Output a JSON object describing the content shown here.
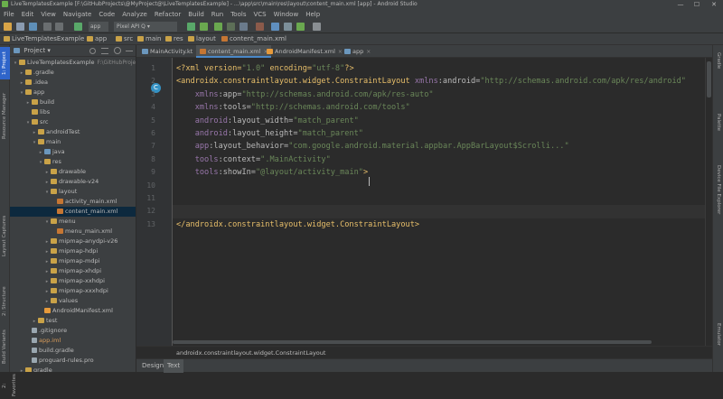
{
  "window": {
    "title": "LiveTemplatesExample [F:\\GitHubProjects\\@MyProject@\\LiveTemplatesExample] - ...\\app\\src\\main\\res\\layout\\content_main.xml [app] - Android Studio",
    "minimize": "—",
    "maximize": "☐",
    "close": "✕"
  },
  "menu": [
    "File",
    "Edit",
    "View",
    "Navigate",
    "Code",
    "Analyze",
    "Refactor",
    "Build",
    "Run",
    "Tools",
    "VCS",
    "Window",
    "Help"
  ],
  "toolbar": {
    "device": "Pixel API Q",
    "device_arrow": "▾",
    "colors": {
      "run": "#59a869",
      "debug": "#6aa84f",
      "build": "#4a88c7"
    }
  },
  "navbar": {
    "items": [
      "LiveTemplatesExample",
      "app",
      "src",
      "main",
      "res",
      "layout",
      "content_main.xml"
    ]
  },
  "left_strip": [
    "1: Project",
    "Resource Manager",
    "Layout Captures",
    "2: Structure",
    "Build Variants",
    "2: Favorites"
  ],
  "right_strip": [
    "Gradle",
    "Palette",
    "Device File Explorer",
    "Emulator"
  ],
  "project_panel": {
    "header": "Project",
    "header_arrow": "▾",
    "tree": [
      {
        "label": "LiveTemplatesExample",
        "extra": "F:\\GitHubProjects\\@",
        "arrow": "▾",
        "level": 0,
        "icon": "folder"
      },
      {
        "label": ".gradle",
        "arrow": "▸",
        "level": 1,
        "icon": "folder"
      },
      {
        "label": ".idea",
        "arrow": "▸",
        "level": 1,
        "icon": "folder"
      },
      {
        "label": "app",
        "arrow": "▾",
        "level": 1,
        "icon": "folder"
      },
      {
        "label": "build",
        "arrow": "▸",
        "level": 2,
        "icon": "folder"
      },
      {
        "label": "libs",
        "arrow": "",
        "level": 2,
        "icon": "folder"
      },
      {
        "label": "src",
        "arrow": "▾",
        "level": 2,
        "icon": "folder"
      },
      {
        "label": "androidTest",
        "arrow": "▸",
        "level": 3,
        "icon": "folder"
      },
      {
        "label": "main",
        "arrow": "▾",
        "level": 3,
        "icon": "folder"
      },
      {
        "label": "java",
        "arrow": "▸",
        "level": 4,
        "icon": "blue"
      },
      {
        "label": "res",
        "arrow": "▾",
        "level": 4,
        "icon": "folder"
      },
      {
        "label": "drawable",
        "arrow": "▸",
        "level": 5,
        "icon": "folder"
      },
      {
        "label": "drawable-v24",
        "arrow": "▸",
        "level": 5,
        "icon": "folder"
      },
      {
        "label": "layout",
        "arrow": "▾",
        "level": 5,
        "icon": "folder"
      },
      {
        "label": "activity_main.xml",
        "arrow": "",
        "level": 6,
        "icon": "lay"
      },
      {
        "label": "content_main.xml",
        "arrow": "",
        "level": 6,
        "icon": "lay",
        "selected": true
      },
      {
        "label": "menu",
        "arrow": "▾",
        "level": 5,
        "icon": "folder"
      },
      {
        "label": "menu_main.xml",
        "arrow": "",
        "level": 6,
        "icon": "lay"
      },
      {
        "label": "mipmap-anydpi-v26",
        "arrow": "▸",
        "level": 5,
        "icon": "folder"
      },
      {
        "label": "mipmap-hdpi",
        "arrow": "▸",
        "level": 5,
        "icon": "folder"
      },
      {
        "label": "mipmap-mdpi",
        "arrow": "▸",
        "level": 5,
        "icon": "folder"
      },
      {
        "label": "mipmap-xhdpi",
        "arrow": "▸",
        "level": 5,
        "icon": "folder"
      },
      {
        "label": "mipmap-xxhdpi",
        "arrow": "▸",
        "level": 5,
        "icon": "folder"
      },
      {
        "label": "mipmap-xxxhdpi",
        "arrow": "▸",
        "level": 5,
        "icon": "folder"
      },
      {
        "label": "values",
        "arrow": "▸",
        "level": 5,
        "icon": "folder"
      },
      {
        "label": "AndroidManifest.xml",
        "arrow": "",
        "level": 4,
        "icon": "xml"
      },
      {
        "label": "test",
        "arrow": "▸",
        "level": 3,
        "icon": "folder"
      },
      {
        "label": ".gitignore",
        "arrow": "",
        "level": 2,
        "icon": "file"
      },
      {
        "label": "app.iml",
        "arrow": "",
        "level": 2,
        "icon": "file",
        "orange": true
      },
      {
        "label": "build.gradle",
        "arrow": "",
        "level": 2,
        "icon": "file"
      },
      {
        "label": "proguard-rules.pro",
        "arrow": "",
        "level": 2,
        "icon": "file"
      },
      {
        "label": "gradle",
        "arrow": "▸",
        "level": 1,
        "icon": "folder"
      }
    ]
  },
  "tabs": [
    {
      "label": "MainActivity.kt",
      "icon": "blue"
    },
    {
      "label": "content_main.xml",
      "icon": "lay",
      "active": true
    },
    {
      "label": "AndroidManifest.xml",
      "icon": "xml"
    },
    {
      "label": "app",
      "icon": "blue"
    }
  ],
  "tab_close": "×",
  "gutter_icon": "C",
  "code_lines": [
    {
      "n": "1",
      "parts": [
        [
          "pi",
          "<?xml version="
        ],
        [
          "s",
          "\"1.0\""
        ],
        [
          "pi",
          " encoding="
        ],
        [
          "s",
          "\"utf-8\""
        ],
        [
          "pi",
          "?>"
        ]
      ]
    },
    {
      "n": "2",
      "parts": [
        [
          "t",
          "<androidx.constraintlayout.widget.ConstraintLayout "
        ],
        [
          "ns",
          "xmlns"
        ],
        [
          "a",
          ":android="
        ],
        [
          "s",
          "\"http://schemas.android.com/apk/res/android\""
        ]
      ]
    },
    {
      "n": "3",
      "parts": [
        [
          "a",
          "    "
        ],
        [
          "ns",
          "xmlns"
        ],
        [
          "a",
          ":app="
        ],
        [
          "s",
          "\"http://schemas.android.com/apk/res-auto\""
        ]
      ]
    },
    {
      "n": "4",
      "parts": [
        [
          "a",
          "    "
        ],
        [
          "ns",
          "xmlns"
        ],
        [
          "a",
          ":tools="
        ],
        [
          "s",
          "\"http://schemas.android.com/tools\""
        ]
      ]
    },
    {
      "n": "5",
      "parts": [
        [
          "a",
          "    "
        ],
        [
          "ns",
          "android"
        ],
        [
          "a",
          ":layout_width="
        ],
        [
          "s",
          "\"match_parent\""
        ]
      ]
    },
    {
      "n": "6",
      "parts": [
        [
          "a",
          "    "
        ],
        [
          "ns",
          "android"
        ],
        [
          "a",
          ":layout_height="
        ],
        [
          "s",
          "\"match_parent\""
        ]
      ]
    },
    {
      "n": "7",
      "parts": [
        [
          "a",
          "    "
        ],
        [
          "ns",
          "app"
        ],
        [
          "a",
          ":layout_behavior="
        ],
        [
          "s",
          "\"com.google.android.material.appbar.AppBarLayout$Scrolli...\""
        ]
      ]
    },
    {
      "n": "8",
      "parts": [
        [
          "a",
          "    "
        ],
        [
          "ns",
          "tools"
        ],
        [
          "a",
          ":context="
        ],
        [
          "s",
          "\".MainActivity\""
        ]
      ]
    },
    {
      "n": "9",
      "parts": [
        [
          "a",
          "    "
        ],
        [
          "ns",
          "tools"
        ],
        [
          "a",
          ":showIn="
        ],
        [
          "s",
          "\"@layout/activity_main\""
        ],
        [
          "t",
          ">"
        ]
      ]
    },
    {
      "n": "10",
      "parts": []
    },
    {
      "n": "11",
      "parts": []
    },
    {
      "n": "12",
      "parts": [],
      "highlight": true
    },
    {
      "n": "13",
      "parts": [
        [
          "t",
          "</androidx.constraintlayout.widget.ConstraintLayout>"
        ]
      ]
    }
  ],
  "breadcrumb": "androidx.constraintlayout.widget.ConstraintLayout",
  "bottom_tabs": [
    {
      "label": "Design"
    },
    {
      "label": "Text",
      "active": true
    }
  ],
  "text_cursor": "I"
}
